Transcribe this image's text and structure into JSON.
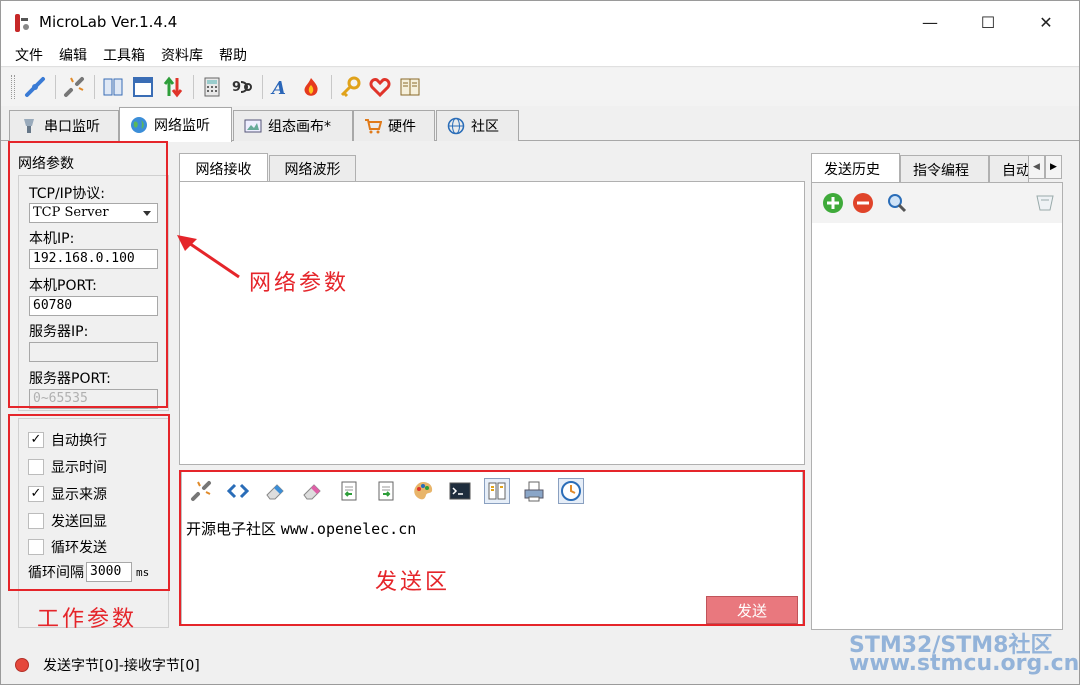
{
  "window": {
    "title": "MicroLab Ver.1.4.4",
    "controls": {
      "minimize": "—",
      "maximize": "☐",
      "close": "✕"
    }
  },
  "menu": [
    "文件",
    "编辑",
    "工具箱",
    "资料库",
    "帮助"
  ],
  "toolbar_icons": [
    "connect-icon",
    "disconnect-icon",
    "split-view-icon",
    "window-icon",
    "transfer-icon",
    "calculator-icon",
    "converter-icon",
    "font-icon",
    "flame-icon",
    "key-icon",
    "heart-icon",
    "book-icon"
  ],
  "main_tabs": [
    {
      "label": "串口监听",
      "icon": "serial-port-icon"
    },
    {
      "label": "网络监听",
      "icon": "globe-icon"
    },
    {
      "label": "组态画布*",
      "icon": "canvas-icon"
    },
    {
      "label": "硬件",
      "icon": "cart-icon"
    },
    {
      "label": "社区",
      "icon": "community-icon"
    }
  ],
  "active_main_tab": "网络监听",
  "network_params": {
    "group_title": "网络参数",
    "protocol_label": "TCP/IP协议:",
    "protocol_value": "TCP Server",
    "local_ip_label": "本机IP:",
    "local_ip_value": "192.168.0.100",
    "local_port_label": "本机PORT:",
    "local_port_value": "60780",
    "server_ip_label": "服务器IP:",
    "server_ip_value": "",
    "server_port_label": "服务器PORT:",
    "server_port_placeholder": "0~65535"
  },
  "work_params": {
    "checkboxes": [
      {
        "label": "自动换行",
        "checked": true
      },
      {
        "label": "显示时间",
        "checked": false
      },
      {
        "label": "显示来源",
        "checked": true
      },
      {
        "label": "发送回显",
        "checked": false
      },
      {
        "label": "循环发送",
        "checked": false
      }
    ],
    "interval_label": "循环间隔",
    "interval_value": "3000",
    "interval_unit": "ms"
  },
  "center_tabs": [
    "网络接收",
    "网络波形"
  ],
  "send_area": {
    "tool_icons": [
      "link-icon",
      "code-icon",
      "eraser-blue-icon",
      "eraser-pink-icon",
      "import-icon",
      "export-icon",
      "palette-icon",
      "terminal-icon",
      "panel-icon",
      "printer-icon",
      "clock-icon"
    ],
    "text": "开源电子社区",
    "url": "www.openelec.cn",
    "send_button": "发送"
  },
  "right_tabs": [
    "发送历史",
    "指令编程",
    "自动"
  ],
  "status": {
    "text": "发送字节[0]-接收字节[0]",
    "dot_color": "#e5483c"
  },
  "annotations": {
    "network": "网络参数",
    "work": "工作参数",
    "send": "发送区",
    "color": "#e5252a"
  },
  "watermark": {
    "line1": "STM32/STM8社区",
    "line2": "www.stmcu.org.cn"
  }
}
